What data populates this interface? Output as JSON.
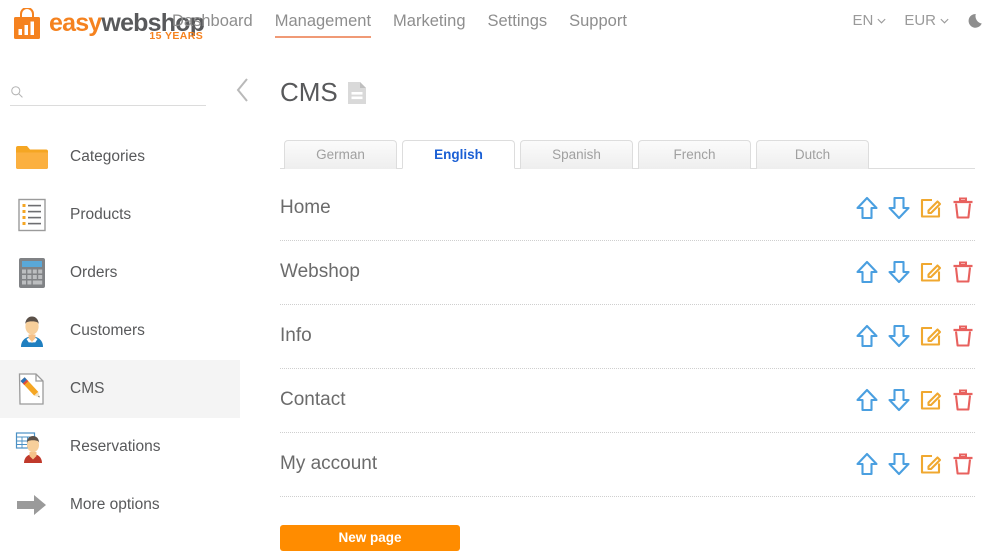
{
  "header": {
    "logo": {
      "part1": "easy",
      "part2": "webshop",
      "tagline": "15 YEARS",
      "icon": "shopping-bag-chart-icon"
    },
    "nav": [
      {
        "label": "Dashboard",
        "active": false
      },
      {
        "label": "Management",
        "active": true
      },
      {
        "label": "Marketing",
        "active": false
      },
      {
        "label": "Settings",
        "active": false
      },
      {
        "label": "Support",
        "active": false
      }
    ],
    "language": "EN",
    "currency": "EUR",
    "theme_icon": "moon-icon"
  },
  "sidebar": {
    "search": {
      "value": "",
      "placeholder": "",
      "icon": "search-icon"
    },
    "collapse_icon": "chevron-left-icon",
    "items": [
      {
        "label": "Categories",
        "icon": "folder-icon",
        "active": false
      },
      {
        "label": "Products",
        "icon": "list-page-icon",
        "active": false
      },
      {
        "label": "Orders",
        "icon": "calculator-icon",
        "active": false
      },
      {
        "label": "Customers",
        "icon": "customer-icon",
        "active": false
      },
      {
        "label": "CMS",
        "icon": "page-pencil-icon",
        "active": true
      },
      {
        "label": "Reservations",
        "icon": "reservation-icon",
        "active": false
      },
      {
        "label": "More options",
        "icon": "arrow-right-icon",
        "active": false
      }
    ]
  },
  "main": {
    "title": "CMS",
    "title_icon": "document-icon",
    "tabs": [
      {
        "label": "German",
        "active": false
      },
      {
        "label": "English",
        "active": true
      },
      {
        "label": "Spanish",
        "active": false
      },
      {
        "label": "French",
        "active": false
      },
      {
        "label": "Dutch",
        "active": false
      }
    ],
    "pages": [
      {
        "name": "Home"
      },
      {
        "name": "Webshop"
      },
      {
        "name": "Info"
      },
      {
        "name": "Contact"
      },
      {
        "name": "My account"
      }
    ],
    "row_actions": [
      {
        "name": "move-up-icon",
        "title": "Move up"
      },
      {
        "name": "move-down-icon",
        "title": "Move down"
      },
      {
        "name": "edit-icon",
        "title": "Edit"
      },
      {
        "name": "delete-icon",
        "title": "Delete"
      }
    ],
    "new_page_button": "New page"
  },
  "colors": {
    "brand_orange": "#f5821f",
    "button_orange": "#ff8c00",
    "active_tab_blue": "#1a5fd4",
    "nav_underline": "#f09a76",
    "arrow_blue": "#4a9fe0",
    "edit_orange": "#f0a830",
    "delete_red": "#e8615e",
    "text_gray": "#58595b"
  }
}
